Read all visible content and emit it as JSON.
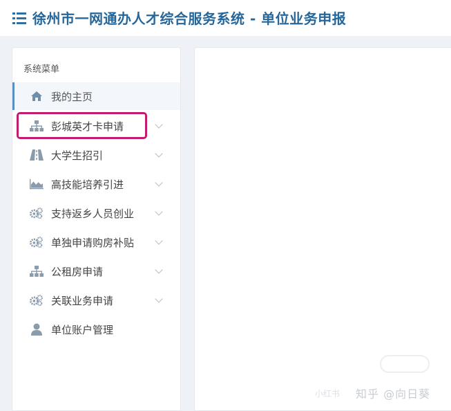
{
  "header": {
    "title": "徐州市一网通办人才综合服务系统 - 单位业务申报",
    "menu_icon": "list-icon"
  },
  "sidebar": {
    "section_title": "系统菜单",
    "items": [
      {
        "label": "我的主页",
        "icon": "home-icon",
        "active": true,
        "has_submenu": false
      },
      {
        "label": "彭城英才卡申请",
        "icon": "sitemap-icon",
        "active": false,
        "has_submenu": true,
        "highlighted": true
      },
      {
        "label": "大学生招引",
        "icon": "road-icon",
        "active": false,
        "has_submenu": true
      },
      {
        "label": "高技能培养引进",
        "icon": "area-chart-icon",
        "active": false,
        "has_submenu": true
      },
      {
        "label": "支持返乡人员创业",
        "icon": "cogs-icon",
        "active": false,
        "has_submenu": true
      },
      {
        "label": "单独申请购房补贴",
        "icon": "cogs-icon",
        "active": false,
        "has_submenu": true
      },
      {
        "label": "公租房申请",
        "icon": "sitemap-icon",
        "active": false,
        "has_submenu": true
      },
      {
        "label": "关联业务申请",
        "icon": "cogs-icon",
        "active": false,
        "has_submenu": true
      },
      {
        "label": "单位账户管理",
        "icon": "user-icon",
        "active": false,
        "has_submenu": false
      }
    ]
  },
  "colors": {
    "title": "#26679b",
    "icon": "#6f8eaa",
    "highlight": "#c11c6e",
    "active_border": "#5b8fc1"
  },
  "watermark": {
    "main": "知乎 @向日葵",
    "small": "小红书"
  }
}
